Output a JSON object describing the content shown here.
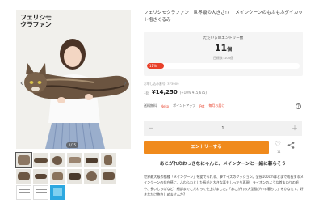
{
  "gallery": {
    "logo_lines": [
      "フェリシモ",
      "クラファン"
    ],
    "counter": "1/15",
    "prev_label": "‹",
    "next_label": "›"
  },
  "product": {
    "title": "フェリシモクラファン　世界級の大きさ!? 　メインクーンのもふもふダイカット抱きぐるみ",
    "meta": "お申し込み番号: 373909",
    "price_prefix": "1回",
    "price": "¥14,250",
    "price_tax": "(+10% ¥15,675)",
    "tags": [
      "送料無料",
      "Neko",
      "ポイントアップ",
      "Pet",
      "毎月お届け"
    ]
  },
  "entry": {
    "label": "ただいまのエントリー数",
    "count": "11",
    "count_unit": "個",
    "goal": "目標数: 100個",
    "progress_label": "11%",
    "progress_value": 0.11
  },
  "purchase": {
    "quantity": "1",
    "minus": "－",
    "plus": "＋",
    "entry_button": "エントリーする",
    "favorite_count": "11"
  },
  "description": {
    "catch": "あこがれのおっきなにゃんこ、メインクーンと一緒に暮らそう",
    "body": "世界最大級の猫種「メインクーン」を愛でられる、夢サイズのクッション。全長100cmほどまで成長するメインクーンの存在感に、ふわふわとした長毛と大きな耳もしっかり再現。ライオンのような首まわりの毛や、長いしっぽなど、細部までこだわって仕上げました。「あこがれの大型猫がいる暮らし」をかなえて、好きなだけ抱きしめませんか?"
  },
  "colors": {
    "accent_orange": "#f08a1c",
    "progress_red": "#e8402a"
  }
}
